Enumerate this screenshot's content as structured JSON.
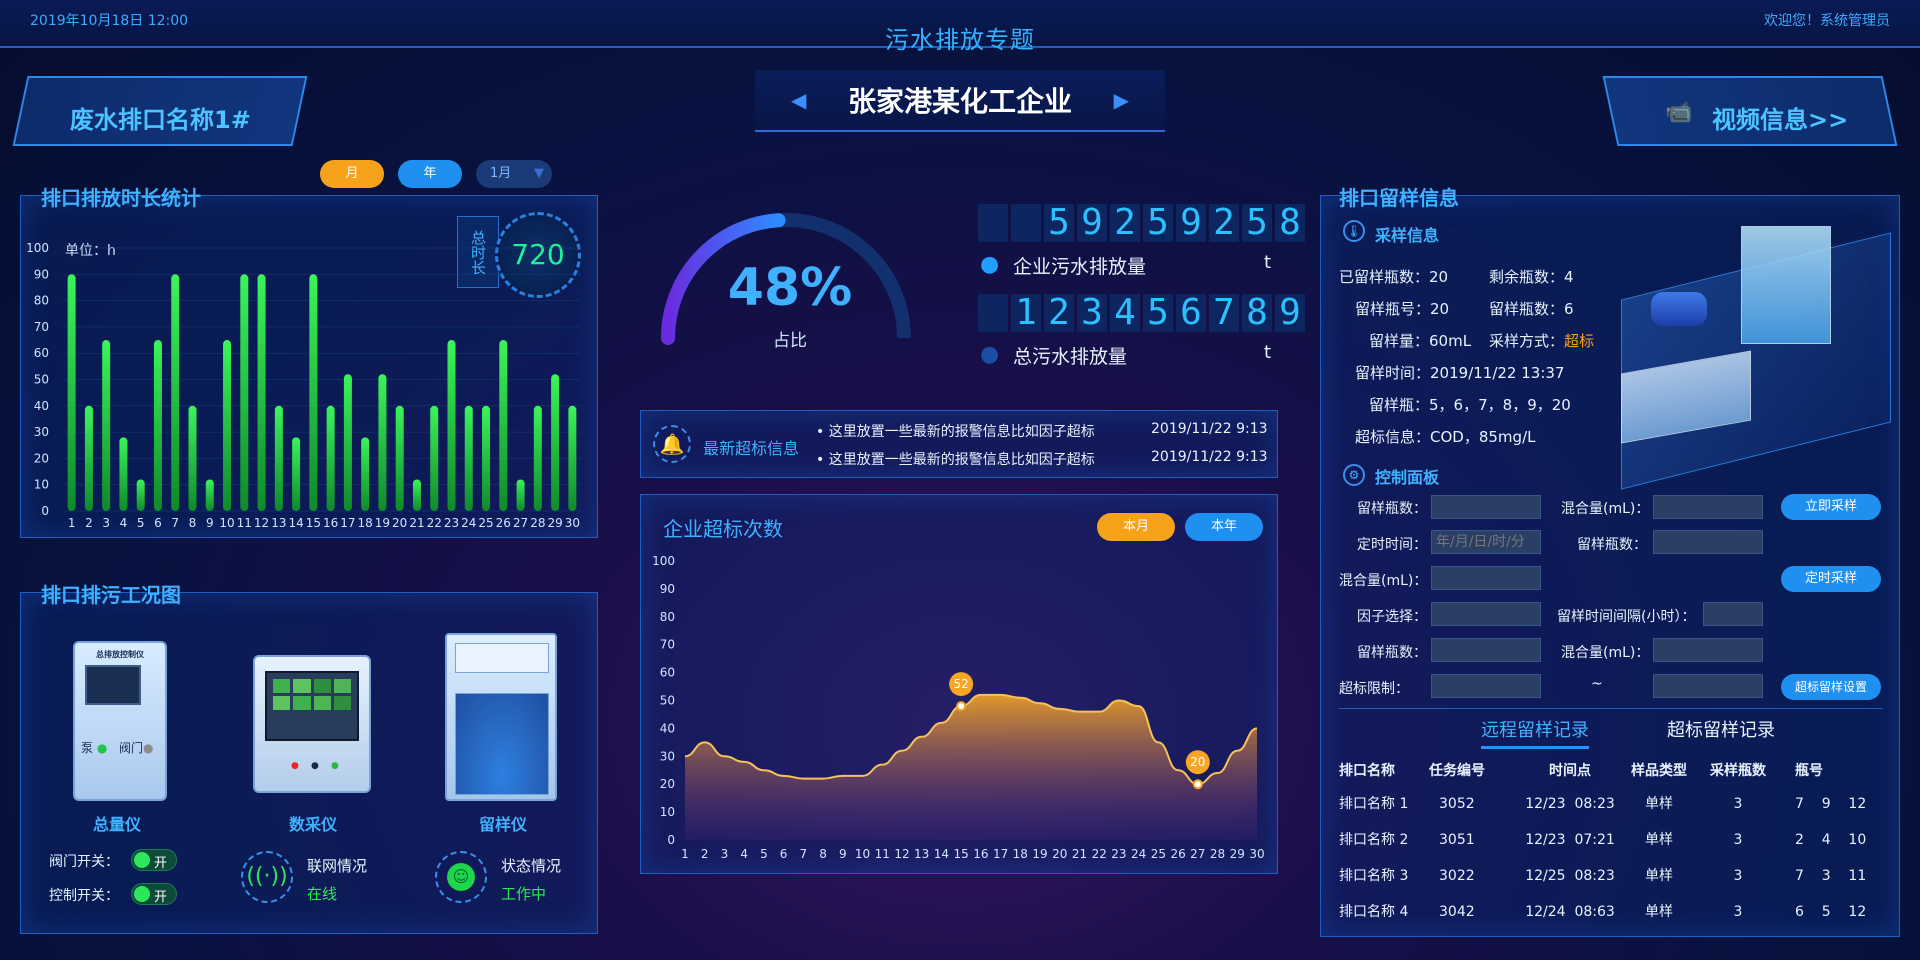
{
  "header": {
    "datetime": "2019年10月18日 12:00",
    "title": "污水排放专题",
    "welcome": "欢迎您！系统管理员"
  },
  "banner": {
    "company": "张家港某化工企业",
    "left_tag": "废水排口名称1#",
    "right_tag": "视频信息>>"
  },
  "filters": {
    "month": "月",
    "year": "年",
    "select": "1月"
  },
  "duration_panel": {
    "title": "排口排放时长统计",
    "unit": "单位：h",
    "total_label": "总时长",
    "total_value": "720"
  },
  "chart_data": [
    {
      "type": "bar",
      "categories": [
        "1",
        "2",
        "3",
        "4",
        "5",
        "6",
        "7",
        "8",
        "9",
        "10",
        "11",
        "12",
        "13",
        "14",
        "15",
        "16",
        "17",
        "18",
        "19",
        "20",
        "21",
        "22",
        "23",
        "24",
        "25",
        "26",
        "27",
        "28",
        "29",
        "30"
      ],
      "values": [
        90,
        40,
        65,
        28,
        12,
        65,
        90,
        40,
        12,
        65,
        90,
        90,
        40,
        28,
        90,
        40,
        52,
        28,
        52,
        40,
        12,
        40,
        65,
        40,
        40,
        65,
        12,
        40,
        52,
        40
      ],
      "ylim": [
        0,
        100
      ],
      "yticks": [
        0,
        10,
        20,
        30,
        40,
        50,
        60,
        70,
        80,
        90,
        100
      ],
      "ylabel": "单位：h"
    },
    {
      "type": "area",
      "title": "企业超标次数",
      "x": [
        "1",
        "2",
        "3",
        "4",
        "5",
        "6",
        "7",
        "8",
        "9",
        "10",
        "11",
        "12",
        "13",
        "14",
        "15",
        "16",
        "17",
        "18",
        "19",
        "20",
        "21",
        "22",
        "23",
        "24",
        "25",
        "26",
        "27",
        "28",
        "29",
        "30"
      ],
      "values": [
        30,
        35,
        30,
        28,
        25,
        23,
        22,
        22,
        23,
        23,
        27,
        32,
        37,
        42,
        48,
        52,
        52,
        51,
        49,
        47,
        46,
        46,
        50,
        48,
        35,
        25,
        20,
        24,
        32,
        40
      ],
      "ylim": [
        0,
        100
      ],
      "yticks": [
        0,
        10,
        20,
        30,
        40,
        50,
        60,
        70,
        80,
        90,
        100
      ],
      "annotations": [
        {
          "x": "15",
          "value": "52"
        },
        {
          "x": "27",
          "value": "20"
        }
      ]
    }
  ],
  "gauge": {
    "value_label": "48%",
    "fraction": 0.48,
    "caption": "占比"
  },
  "counters": [
    {
      "digits": [
        "",
        "",
        "5",
        "9",
        "2",
        "5",
        "9",
        "2",
        "5",
        "8"
      ],
      "label": "企业污水排放量",
      "unit": "t"
    },
    {
      "digits": [
        "",
        "1",
        "2",
        "3",
        "4",
        "5",
        "6",
        "7",
        "8",
        "9"
      ],
      "label": "总污水排放量",
      "unit": "t"
    }
  ],
  "alerts": {
    "label": "最新超标信息",
    "items": [
      {
        "text": "这里放置一些最新的报警信息比如因子超标",
        "time": "2019/11/22 9:13"
      },
      {
        "text": "这里放置一些最新的报警信息比如因子超标",
        "time": "2019/11/22 9:13"
      }
    ]
  },
  "exceed_panel": {
    "title": "企业超标次数",
    "btn_month": "本月",
    "btn_year": "本年"
  },
  "status_panel": {
    "title": "排口排污工况图",
    "devices": [
      {
        "name": "总量仪",
        "screen_title": "总排放控制仪",
        "pump": "泵",
        "valve": "阀门"
      },
      {
        "name": "数采仪"
      },
      {
        "name": "留样仪"
      }
    ],
    "valve_switch": "阀门开关：",
    "ctrl_switch": "控制开关：",
    "on": "开",
    "network_label": "联网情况",
    "network_value": "在线",
    "state_label": "状态情况",
    "state_value": "工作中"
  },
  "sample_panel": {
    "title": "排口留样信息",
    "info_title": "采样信息",
    "fields": [
      {
        "k": "已留样瓶数：",
        "v": "20"
      },
      {
        "k": "剩余瓶数：",
        "v": "4"
      },
      {
        "k": "留样瓶号：",
        "v": "20"
      },
      {
        "k": "留样瓶数：",
        "v": "6"
      },
      {
        "k": "留样量：",
        "v": "60mL"
      },
      {
        "k": "采样方式：",
        "v": "超标"
      },
      {
        "k": "留样时间：",
        "v": "2019/11/22 13:37"
      },
      {
        "k": "留样瓶：",
        "v": "5，6，7，8，9，20"
      },
      {
        "k": "超标信息：",
        "v": "COD，85mg/L"
      }
    ],
    "control_title": "控制面板",
    "controls": {
      "bottles": "留样瓶数：",
      "mix": "混合量(mL)：",
      "timing": "定时时间：",
      "timing_placeholder": "年/月/日/时/分",
      "factor": "因子选择：",
      "interval": "留样时间间隔(小时）：",
      "limit": "超标限制：",
      "tilde": "~",
      "btn_now": "立即采样",
      "btn_timed": "定时采样",
      "btn_exceed": "超标留样设置"
    },
    "tabs": [
      "远程留样记录",
      "超标留样记录"
    ],
    "table": {
      "headers": [
        "排口名称",
        "任务编号",
        "时间点",
        "样品类型",
        "采样瓶数",
        "瓶号"
      ],
      "rows": [
        [
          "排口名称 1",
          "3052",
          "12/23  08:23",
          "单样",
          "3",
          "7    9    12"
        ],
        [
          "排口名称 2",
          "3051",
          "12/23  07:21",
          "单样",
          "3",
          "2    4    10"
        ],
        [
          "排口名称 3",
          "3022",
          "12/25  08:23",
          "单样",
          "3",
          "7    3    11"
        ],
        [
          "排口名称 4",
          "3042",
          "12/24  08:63",
          "单样",
          "3",
          "6    5    12"
        ]
      ]
    }
  },
  "colors": {
    "accent": "#3fb1ff",
    "bar": "#2ee64a",
    "area": "#f6a623",
    "orange": "#f7a21b",
    "blue_btn": "#1f8ff0"
  }
}
